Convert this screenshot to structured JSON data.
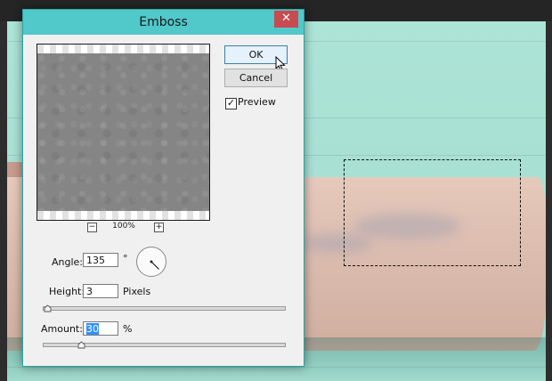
{
  "dialog": {
    "title": "Emboss",
    "close_glyph": "✕",
    "ok_label": "OK",
    "cancel_label": "Cancel",
    "preview_checkbox": {
      "label": "Preview",
      "checked": true,
      "check_glyph": "✓"
    },
    "zoom": {
      "out_glyph": "−",
      "in_glyph": "+",
      "level": "100%"
    },
    "angle": {
      "label": "Angle:",
      "value": "135",
      "unit": "°",
      "degrees": 135
    },
    "height": {
      "label": "Height:",
      "value": "3",
      "unit": "Pixels",
      "slider_fraction": 0.02
    },
    "amount": {
      "label": "Amount:",
      "value": "30",
      "unit": "%",
      "slider_fraction": 0.16
    }
  },
  "colors": {
    "titlebar": "#51c8ca",
    "close_button": "#c74b50",
    "canvas_background": "#a7e2d4",
    "selection_highlight": "#3390ff"
  },
  "icons": [
    "close-icon",
    "zoom-out-icon",
    "zoom-in-icon",
    "checkmark-icon",
    "mouse-pointer-icon",
    "angle-dial-icon"
  ]
}
